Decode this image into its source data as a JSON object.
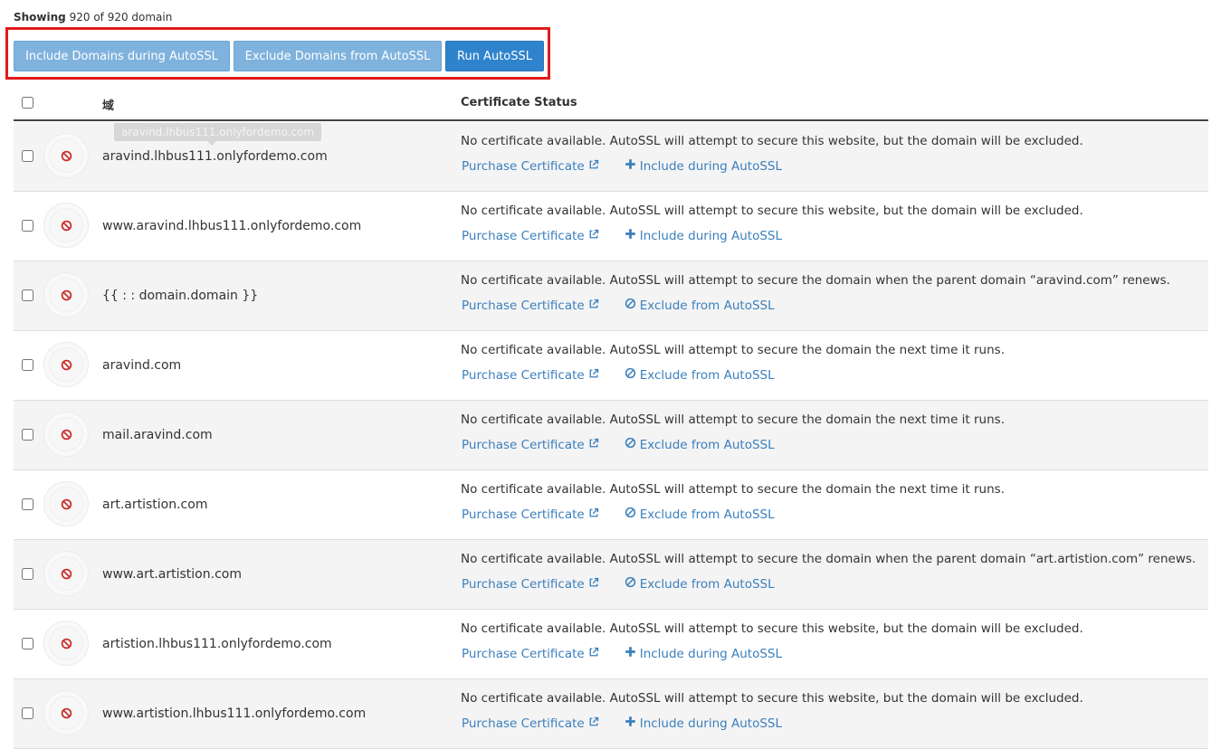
{
  "header": {
    "showing_label": "Showing",
    "showing_count": "920 of 920 domain"
  },
  "toolbar": {
    "include_label": "Include Domains during AutoSSL",
    "exclude_label": "Exclude Domains from AutoSSL",
    "run_label": "Run AutoSSL"
  },
  "table": {
    "col_domain": "域",
    "col_status": "Certificate Status"
  },
  "tooltip": "aravind.lhbus111.onlyfordemo.com",
  "links": {
    "purchase": "Purchase Certificate",
    "include": "Include during AutoSSL",
    "exclude": "Exclude from AutoSSL"
  },
  "rows": [
    {
      "domain": "aravind.lhbus111.onlyfordemo.com",
      "status": "No certificate available. AutoSSL will attempt to secure this website, but the domain will be excluded.",
      "action": "include"
    },
    {
      "domain": "www.aravind.lhbus111.onlyfordemo.com",
      "status": "No certificate available. AutoSSL will attempt to secure this website, but the domain will be excluded.",
      "action": "include"
    },
    {
      "domain": "{{ :  :   domain.domain }}",
      "status": "No certificate available. AutoSSL will attempt to secure the domain when the parent domain “aravind.com” renews.",
      "action": "exclude"
    },
    {
      "domain": "aravind.com",
      "status": "No certificate available. AutoSSL will attempt to secure the domain the next time it runs.",
      "action": "exclude"
    },
    {
      "domain": "mail.aravind.com",
      "status": "No certificate available. AutoSSL will attempt to secure the domain the next time it runs.",
      "action": "exclude"
    },
    {
      "domain": "art.artistion.com",
      "status": "No certificate available. AutoSSL will attempt to secure the domain the next time it runs.",
      "action": "exclude"
    },
    {
      "domain": "www.art.artistion.com",
      "status": "No certificate available. AutoSSL will attempt to secure the domain when the parent domain “art.artistion.com” renews.",
      "action": "exclude"
    },
    {
      "domain": "artistion.lhbus111.onlyfordemo.com",
      "status": "No certificate available. AutoSSL will attempt to secure this website, but the domain will be excluded.",
      "action": "include"
    },
    {
      "domain": "www.artistion.lhbus111.onlyfordemo.com",
      "status": "No certificate available. AutoSSL will attempt to secure this website, but the domain will be excluded.",
      "action": "include"
    }
  ]
}
